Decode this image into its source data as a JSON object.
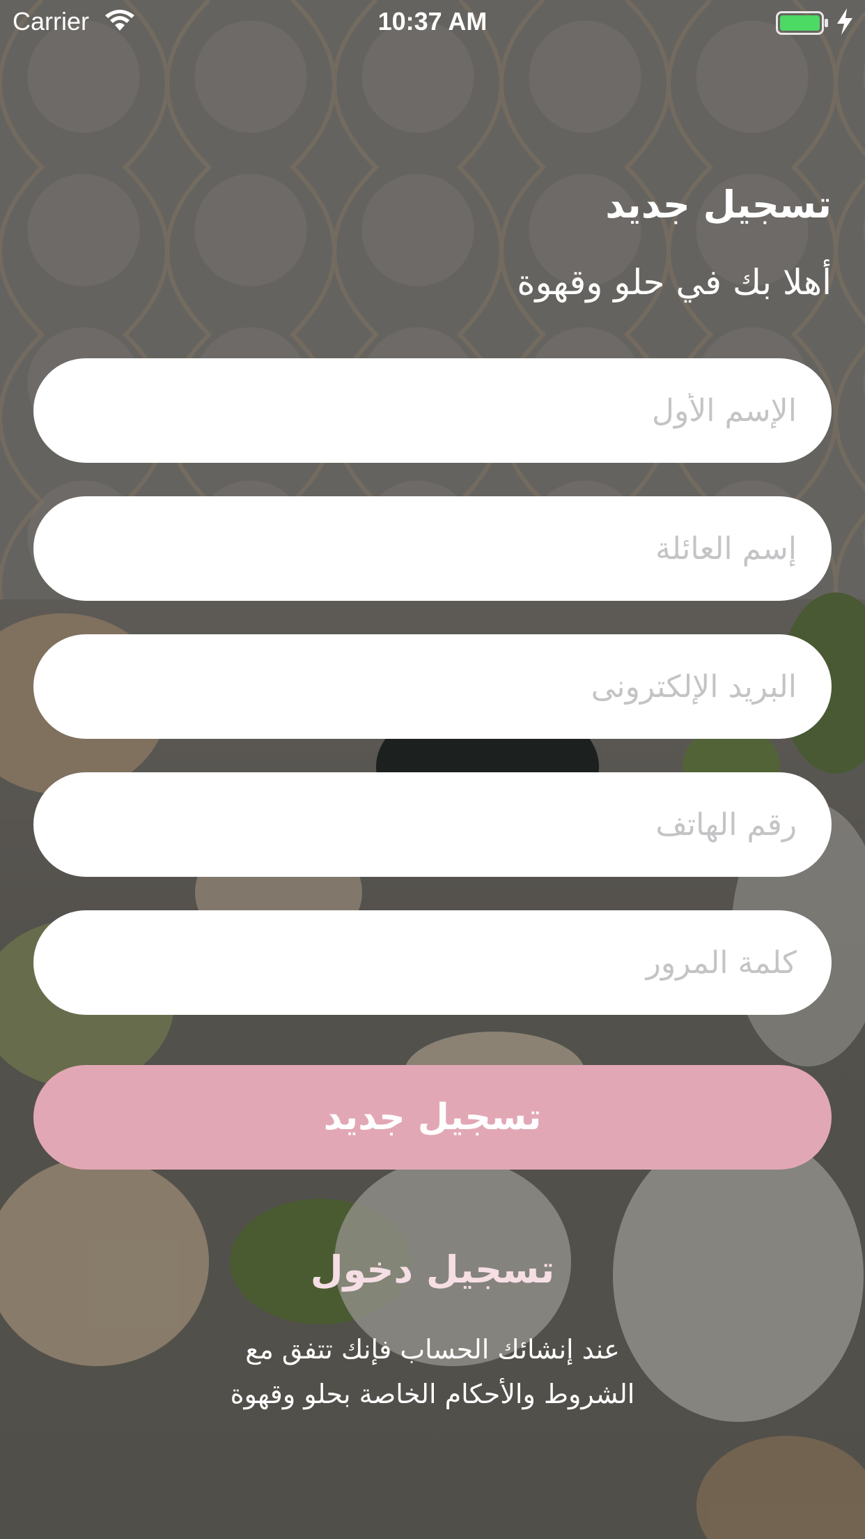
{
  "status_bar": {
    "carrier": "Carrier",
    "time": "10:37 AM",
    "wifi_icon": "wifi-icon",
    "battery_icon": "battery-icon",
    "battery_color": "#4cd964",
    "charging_icon": "bolt-icon"
  },
  "header": {
    "title": "تسجيل جديد",
    "subtitle": "أهلا بك في حلو وقهوة"
  },
  "form": {
    "first_name_placeholder": "الإسم الأول",
    "last_name_placeholder": "إسم العائلة",
    "email_placeholder": "البريد الإلكترونى",
    "phone_placeholder": "رقم الهاتف",
    "password_placeholder": "كلمة المرور",
    "submit_label": "تسجيل جديد"
  },
  "footer": {
    "login_label": "تسجيل دخول",
    "terms_line1": "عند إنشائك الحساب فإنك تتفق مع",
    "terms_line2": "الشروط والأحكام الخاصة بحلو وقهوة"
  },
  "colors": {
    "accent": "#e2a7b5",
    "login_text": "#f6dfe4",
    "placeholder": "#c4c4c6"
  }
}
